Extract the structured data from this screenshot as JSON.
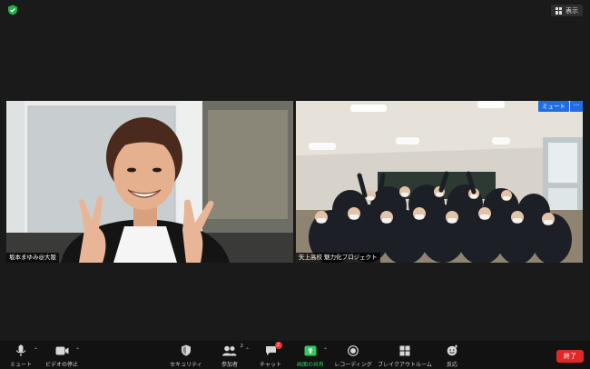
{
  "top_bar": {
    "view_label": "表示"
  },
  "participants": [
    {
      "name": "坂本まゆみ@大阪"
    },
    {
      "name": "矢上高校 魅力化プロジェクト",
      "mute_label": "ミュート",
      "more_label": "···"
    }
  ],
  "toolbar": {
    "mute": "ミュート",
    "video": "ビデオの停止",
    "security": "セキュリティ",
    "participants": "参加者",
    "participants_count": "2",
    "chat": "チャット",
    "chat_badge": "2",
    "share": "画面の共有",
    "record": "レコーディング",
    "breakout": "ブレイクアウトルーム",
    "reactions": "反応",
    "end": "終了"
  },
  "colors": {
    "accent": "#1f6ee6",
    "share_green": "#2ecc5c",
    "end_red": "#e02828",
    "badge_red": "#e33333"
  }
}
